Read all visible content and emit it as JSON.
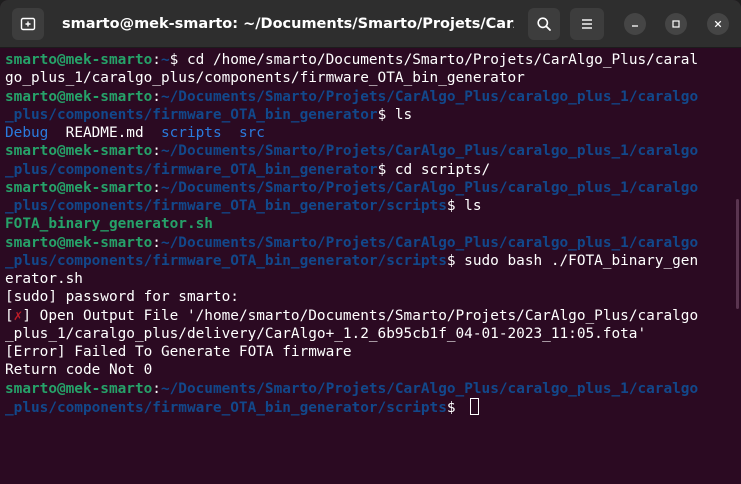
{
  "window": {
    "title": "smarto@mek-smarto: ~/Documents/Smarto/Projets/CarAlgo..."
  },
  "terminal": {
    "lines": [
      {
        "segments": [
          {
            "text": "smarto@mek-smarto",
            "style": "user"
          },
          {
            "text": ":",
            "style": "plain"
          },
          {
            "text": "~",
            "style": "path"
          },
          {
            "text": "$ cd /home/smarto/Documents/Smarto/Projets/CarAlgo_Plus/caral",
            "style": "plain"
          }
        ]
      },
      {
        "segments": [
          {
            "text": "go_plus_1/caralgo_plus/components/firmware_OTA_bin_generator",
            "style": "plain"
          }
        ]
      },
      {
        "segments": [
          {
            "text": "smarto@mek-smarto",
            "style": "user"
          },
          {
            "text": ":",
            "style": "plain"
          },
          {
            "text": "~/Documents/Smarto/Projets/CarAlgo_Plus/caralgo_plus_1/caralgo",
            "style": "path"
          }
        ]
      },
      {
        "segments": [
          {
            "text": "_plus/components/firmware_OTA_bin_generator",
            "style": "path"
          },
          {
            "text": "$ ls",
            "style": "plain"
          }
        ]
      },
      {
        "segments": [
          {
            "text": "Debug",
            "style": "dir"
          },
          {
            "text": "  README.md  ",
            "style": "plain"
          },
          {
            "text": "scripts",
            "style": "dir"
          },
          {
            "text": "  ",
            "style": "plain"
          },
          {
            "text": "src",
            "style": "dir"
          }
        ]
      },
      {
        "segments": [
          {
            "text": "smarto@mek-smarto",
            "style": "user"
          },
          {
            "text": ":",
            "style": "plain"
          },
          {
            "text": "~/Documents/Smarto/Projets/CarAlgo_Plus/caralgo_plus_1/caralgo",
            "style": "path"
          }
        ]
      },
      {
        "segments": [
          {
            "text": "_plus/components/firmware_OTA_bin_generator",
            "style": "path"
          },
          {
            "text": "$ cd scripts/",
            "style": "plain"
          }
        ]
      },
      {
        "segments": [
          {
            "text": "smarto@mek-smarto",
            "style": "user"
          },
          {
            "text": ":",
            "style": "plain"
          },
          {
            "text": "~/Documents/Smarto/Projets/CarAlgo_Plus/caralgo_plus_1/caralgo",
            "style": "path"
          }
        ]
      },
      {
        "segments": [
          {
            "text": "_plus/components/firmware_OTA_bin_generator/scripts",
            "style": "path"
          },
          {
            "text": "$ ls",
            "style": "plain"
          }
        ]
      },
      {
        "segments": [
          {
            "text": "FOTA_binary_generator.sh",
            "style": "exe"
          }
        ]
      },
      {
        "segments": [
          {
            "text": "smarto@mek-smarto",
            "style": "user"
          },
          {
            "text": ":",
            "style": "plain"
          },
          {
            "text": "~/Documents/Smarto/Projets/CarAlgo_Plus/caralgo_plus_1/caralgo",
            "style": "path"
          }
        ]
      },
      {
        "segments": [
          {
            "text": "_plus/components/firmware_OTA_bin_generator/scripts",
            "style": "path"
          },
          {
            "text": "$ sudo bash ./FOTA_binary_gen",
            "style": "plain"
          }
        ]
      },
      {
        "segments": [
          {
            "text": "erator.sh",
            "style": "plain"
          }
        ]
      },
      {
        "segments": [
          {
            "text": "[sudo] password for smarto:",
            "style": "plain"
          }
        ]
      },
      {
        "segments": [
          {
            "text": "[",
            "style": "plain"
          },
          {
            "text": "✗",
            "style": "cross"
          },
          {
            "text": "] Open Output File '/home/smarto/Documents/Smarto/Projets/CarAlgo_Plus/caralgo",
            "style": "plain"
          }
        ]
      },
      {
        "segments": [
          {
            "text": "_plus_1/caralgo_plus/delivery/CarAlgo+_1.2_6b95cb1f_04-01-2023_11:05.fota'",
            "style": "plain"
          }
        ]
      },
      {
        "segments": [
          {
            "text": "[Error] Failed To Generate FOTA firmware",
            "style": "plain"
          }
        ]
      },
      {
        "segments": [
          {
            "text": "Return code Not 0",
            "style": "plain"
          }
        ]
      },
      {
        "segments": [
          {
            "text": "smarto@mek-smarto",
            "style": "user"
          },
          {
            "text": ":",
            "style": "plain"
          },
          {
            "text": "~/Documents/Smarto/Projets/CarAlgo_Plus/caralgo_plus_1/caralgo",
            "style": "path"
          }
        ]
      },
      {
        "segments": [
          {
            "text": "_plus/components/firmware_OTA_bin_generator/scripts",
            "style": "path"
          },
          {
            "text": "$ ",
            "style": "plain"
          }
        ],
        "cursor": true
      }
    ]
  },
  "icons": {
    "new_tab": "new-tab-icon",
    "search": "search-icon",
    "menu": "hamburger-menu-icon",
    "minimize": "minimize-icon",
    "maximize": "maximize-icon",
    "close": "close-icon"
  },
  "colors": {
    "background": "#2b0a22",
    "titlebar": "#2e2e2e",
    "prompt_user": "#26a269",
    "prompt_path": "#12488b",
    "directory": "#2a7bde",
    "executable": "#26a269",
    "error_mark": "#c01c28",
    "text": "#ffffff"
  }
}
